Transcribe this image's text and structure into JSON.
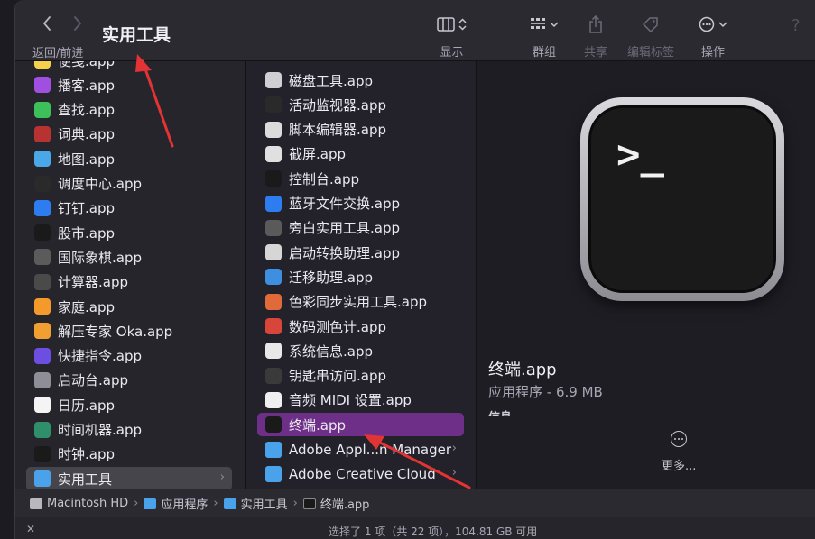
{
  "toolbar": {
    "title": "实用工具",
    "nav_label": "返回/前进",
    "view_label": "显示",
    "group_label": "群组",
    "share_label": "共享",
    "tags_label": "编辑标签",
    "action_label": "操作",
    "help": "?"
  },
  "sidebar": {
    "items": [
      {
        "label": "便笺.app",
        "icon": "notes-icon",
        "color": "#f5d04a"
      },
      {
        "label": "播客.app",
        "icon": "podcasts-icon",
        "color": "#a14fe0"
      },
      {
        "label": "查找.app",
        "icon": "findmy-icon",
        "color": "#3dbf5a"
      },
      {
        "label": "词典.app",
        "icon": "dictionary-icon",
        "color": "#b83232"
      },
      {
        "label": "地图.app",
        "icon": "maps-icon",
        "color": "#4aa8e8"
      },
      {
        "label": "调度中心.app",
        "icon": "mission-control-icon",
        "color": "#2a2a2a"
      },
      {
        "label": "钉钉.app",
        "icon": "dingtalk-icon",
        "color": "#2d7cf0"
      },
      {
        "label": "股市.app",
        "icon": "stocks-icon",
        "color": "#1a1a1a"
      },
      {
        "label": "国际象棋.app",
        "icon": "chess-icon",
        "color": "#5b5b5b"
      },
      {
        "label": "计算器.app",
        "icon": "calculator-icon",
        "color": "#4a4a4a"
      },
      {
        "label": "家庭.app",
        "icon": "home-icon",
        "color": "#f39a2b"
      },
      {
        "label": "解压专家 Oka.app",
        "icon": "oka-icon",
        "color": "#f0a030"
      },
      {
        "label": "快捷指令.app",
        "icon": "shortcuts-icon",
        "color": "#6c4ee0"
      },
      {
        "label": "启动台.app",
        "icon": "launchpad-icon",
        "color": "#8e8e96"
      },
      {
        "label": "日历.app",
        "icon": "calendar-icon",
        "color": "#f4f4f4"
      },
      {
        "label": "时间机器.app",
        "icon": "time-machine-icon",
        "color": "#2f8f6a"
      },
      {
        "label": "时钟.app",
        "icon": "clock-icon",
        "color": "#1a1a1a"
      },
      {
        "label": "实用工具",
        "icon": "folder-icon",
        "color": "#4aa3ea"
      }
    ]
  },
  "utilities": {
    "items": [
      {
        "label": "磁盘工具.app",
        "icon": "disk-utility-icon",
        "color": "#cfcfd4"
      },
      {
        "label": "活动监视器.app",
        "icon": "activity-monitor-icon",
        "color": "#2a2a2a"
      },
      {
        "label": "脚本编辑器.app",
        "icon": "script-editor-icon",
        "color": "#dcdcdc"
      },
      {
        "label": "截屏.app",
        "icon": "screenshot-icon",
        "color": "#e0e0e0"
      },
      {
        "label": "控制台.app",
        "icon": "console-icon",
        "color": "#1a1a1a"
      },
      {
        "label": "蓝牙文件交换.app",
        "icon": "bluetooth-icon",
        "color": "#2d7cf0"
      },
      {
        "label": "旁白实用工具.app",
        "icon": "voiceover-icon",
        "color": "#5a5a5a"
      },
      {
        "label": "启动转换助理.app",
        "icon": "bootcamp-icon",
        "color": "#d6d6d6"
      },
      {
        "label": "迁移助理.app",
        "icon": "migration-icon",
        "color": "#3f8fe0"
      },
      {
        "label": "色彩同步实用工具.app",
        "icon": "colorsync-icon",
        "color": "#e06a3a"
      },
      {
        "label": "数码测色计.app",
        "icon": "colorimeter-icon",
        "color": "#d8453a"
      },
      {
        "label": "系统信息.app",
        "icon": "system-info-icon",
        "color": "#e8e8e8"
      },
      {
        "label": "钥匙串访问.app",
        "icon": "keychain-icon",
        "color": "#3a3a3a"
      },
      {
        "label": "音频 MIDI 设置.app",
        "icon": "midi-icon",
        "color": "#f0f0f0"
      },
      {
        "label": "终端.app",
        "icon": "terminal-icon",
        "color": "#1a1a1a"
      },
      {
        "label": "Adobe Appl...n Manager",
        "icon": "folder-icon",
        "color": "#4aa3ea"
      },
      {
        "label": "Adobe Creative Cloud",
        "icon": "folder-icon",
        "color": "#4aa3ea"
      }
    ]
  },
  "preview": {
    "name": "终端.app",
    "kind": "应用程序 - 6.9 MB",
    "info_heading": "信息",
    "more_label": "更多...",
    "prompt_glyph": ">_"
  },
  "pathbar": {
    "items": [
      "Macintosh HD",
      "应用程序",
      "实用工具",
      "终端.app"
    ]
  },
  "status": {
    "text": "选择了 1 项（共 22 项），104.81 GB 可用",
    "close": "✕"
  },
  "colors": {
    "selection_purple": "#6e2f88",
    "annotation_red": "#e23434"
  }
}
